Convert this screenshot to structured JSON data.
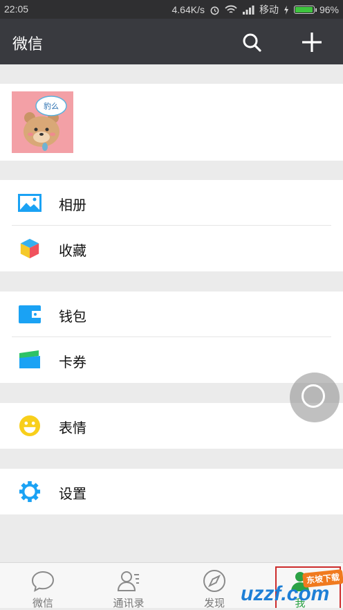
{
  "status_bar": {
    "time": "22:05",
    "speed": "4.64K/s",
    "carrier": "移动",
    "battery_text": "96%",
    "battery_level": 0.96
  },
  "header": {
    "title": "微信"
  },
  "menu": {
    "album": "相册",
    "favorites": "收藏",
    "wallet": "钱包",
    "cards": "卡券",
    "stickers": "表情",
    "settings": "设置"
  },
  "avatar_caption": "豹么",
  "tabs": [
    {
      "label": "微信",
      "icon": "chat-bubble-icon"
    },
    {
      "label": "通讯录",
      "icon": "contacts-icon"
    },
    {
      "label": "发现",
      "icon": "compass-icon"
    },
    {
      "label": "我",
      "icon": "person-icon"
    }
  ],
  "watermark": {
    "text": "uzzf.com",
    "badge": "东坡下载"
  },
  "colors": {
    "accent_green": "#2ba245",
    "header_bg": "#393a3f",
    "icon_blue": "#1aa2f4"
  }
}
